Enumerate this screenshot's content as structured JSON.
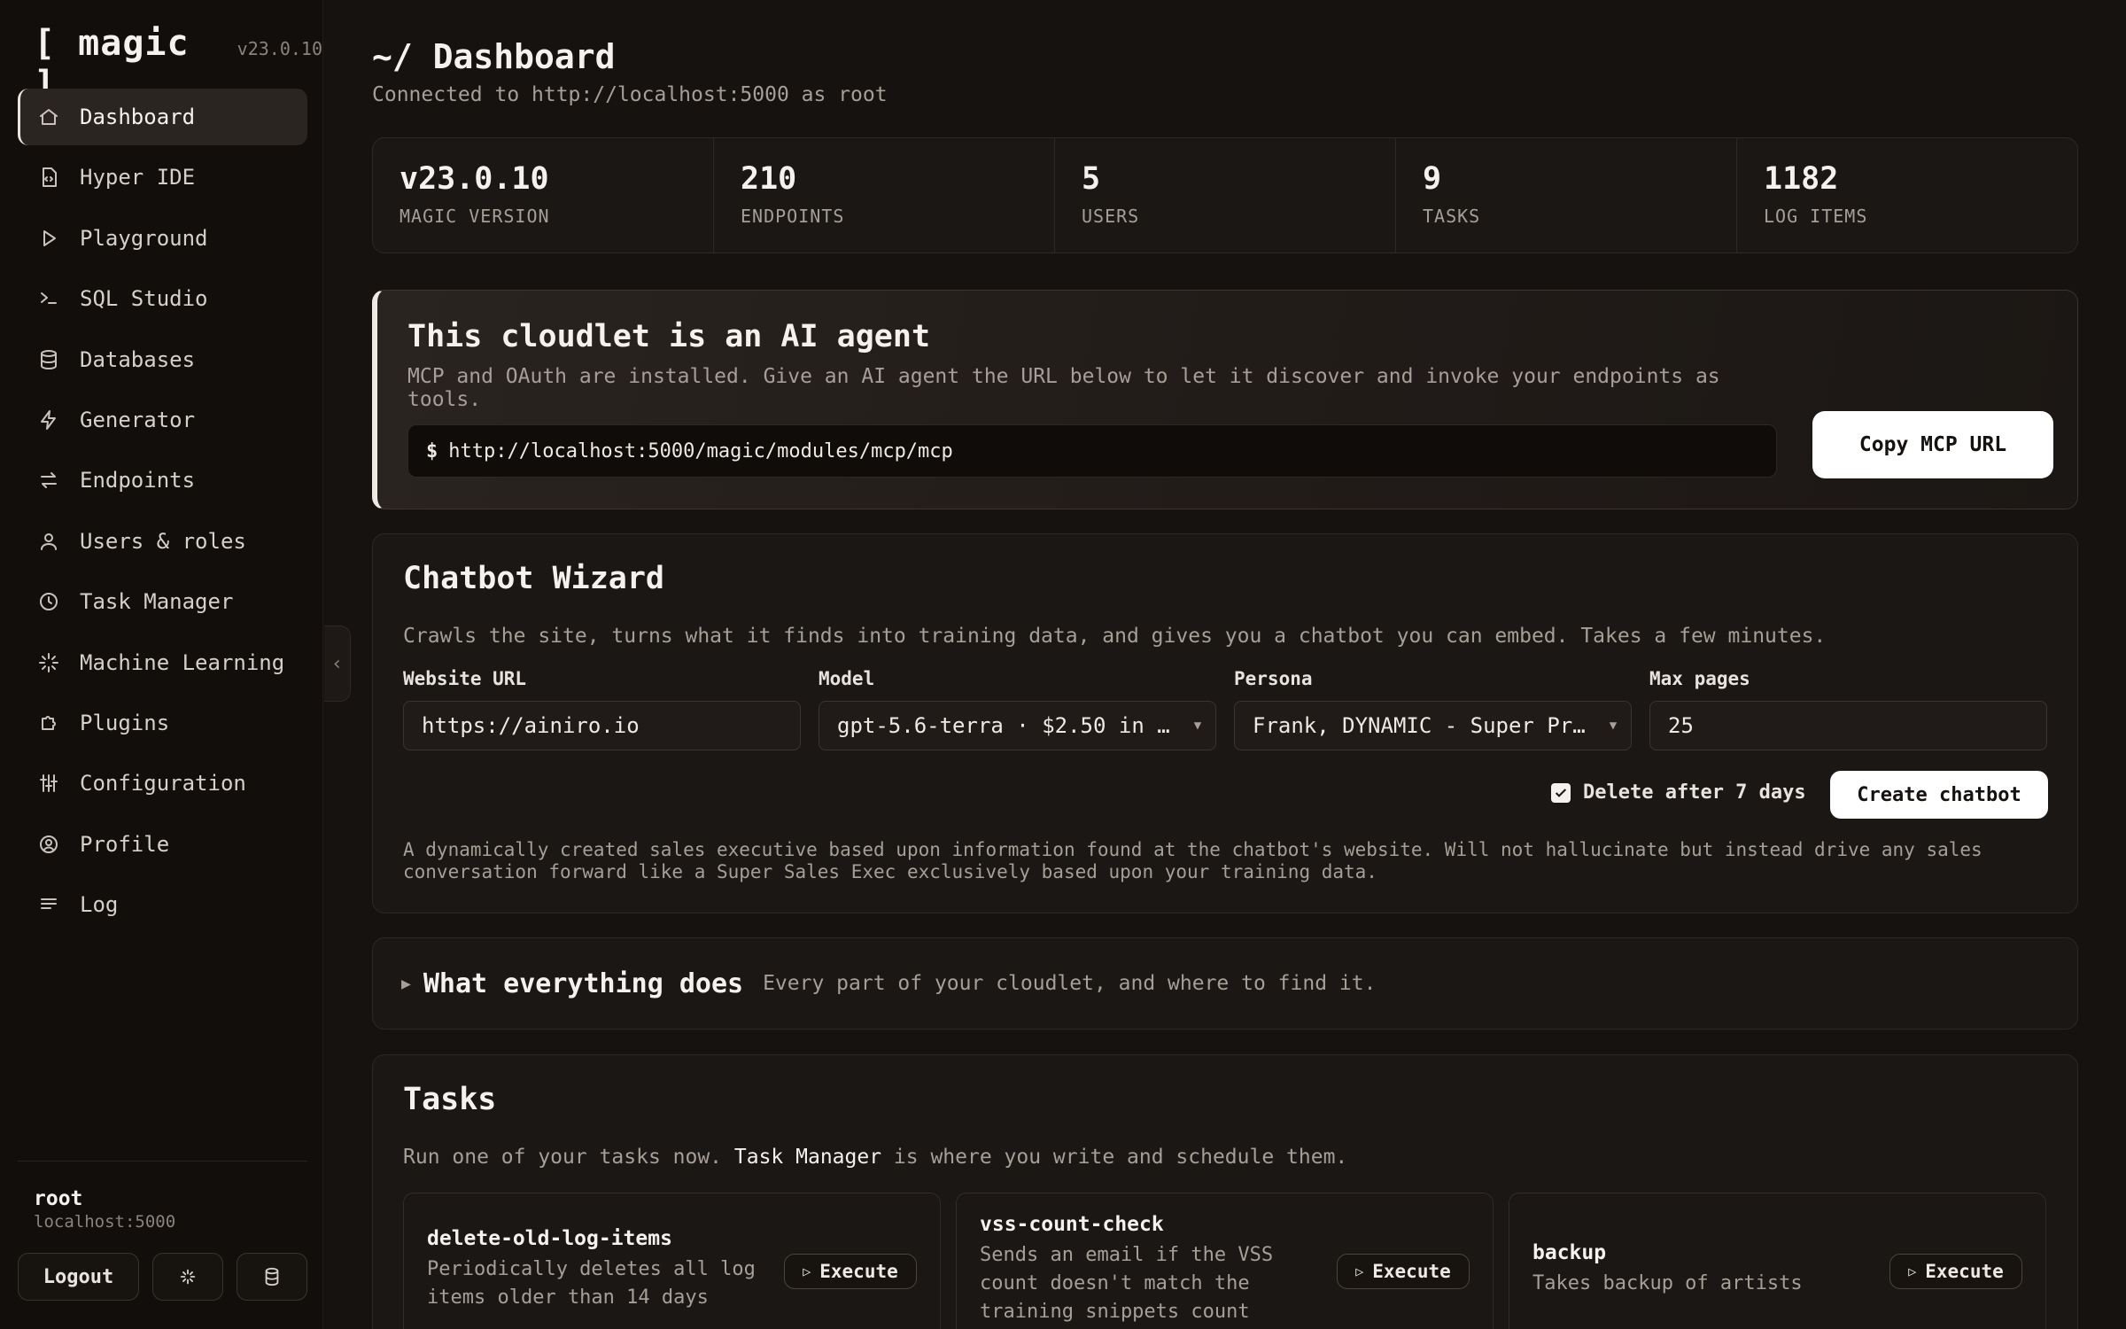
{
  "brand": {
    "name": "[ magic ]",
    "version": "v23.0.10"
  },
  "sidebar": {
    "items": [
      {
        "label": "Dashboard",
        "icon": "home-icon",
        "active": true
      },
      {
        "label": "Hyper IDE",
        "icon": "file-code-icon"
      },
      {
        "label": "Playground",
        "icon": "play-icon"
      },
      {
        "label": "SQL Studio",
        "icon": "terminal-icon"
      },
      {
        "label": "Databases",
        "icon": "database-icon"
      },
      {
        "label": "Generator",
        "icon": "lightning-icon"
      },
      {
        "label": "Endpoints",
        "icon": "arrows-swap-icon"
      },
      {
        "label": "Users & roles",
        "icon": "user-icon"
      },
      {
        "label": "Task Manager",
        "icon": "clock-icon"
      },
      {
        "label": "Machine Learning",
        "icon": "sparkle-icon"
      },
      {
        "label": "Plugins",
        "icon": "puzzle-icon"
      },
      {
        "label": "Configuration",
        "icon": "sliders-icon"
      },
      {
        "label": "Profile",
        "icon": "user-circle-icon"
      },
      {
        "label": "Log",
        "icon": "lines-icon"
      }
    ],
    "user": {
      "name": "root",
      "host": "localhost:5000"
    },
    "logout_label": "Logout"
  },
  "header": {
    "title": "~/ Dashboard",
    "subtitle": "Connected to http://localhost:5000 as root"
  },
  "stats": [
    {
      "value": "v23.0.10",
      "label": "MAGIC VERSION"
    },
    {
      "value": "210",
      "label": "ENDPOINTS"
    },
    {
      "value": "5",
      "label": "USERS"
    },
    {
      "value": "9",
      "label": "TASKS"
    },
    {
      "value": "1182",
      "label": "LOG ITEMS"
    }
  ],
  "agent": {
    "title": "This cloudlet is an AI agent",
    "description": "MCP and OAuth are installed. Give an AI agent the URL below to let it discover and invoke your endpoints as tools.",
    "prompt": "$",
    "url": "http://localhost:5000/magic/modules/mcp/mcp",
    "copy_label": "Copy MCP URL"
  },
  "wizard": {
    "title": "Chatbot Wizard",
    "description": "Crawls the site, turns what it finds into training data, and gives you a chatbot you can embed. Takes a few minutes.",
    "fields": {
      "website_label": "Website URL",
      "website_value": "https://ainiro.io",
      "model_label": "Model",
      "model_value": "gpt-5.6-terra · $2.50 in …",
      "persona_label": "Persona",
      "persona_value": "Frank, DYNAMIC - Super Pr…",
      "maxpages_label": "Max pages",
      "maxpages_value": "25"
    },
    "delete_label": "Delete after 7 days",
    "delete_checked": true,
    "create_label": "Create chatbot",
    "persona_description": "A dynamically created sales executive based upon information found at the chatbot's website. Will not hallucinate but instead drive any sales conversation forward like a Super Sales Exec exclusively based upon your training data."
  },
  "what": {
    "title": "What everything does",
    "subtitle": "Every part of your cloudlet, and where to find it."
  },
  "tasks": {
    "title": "Tasks",
    "desc_before": "Run one of your tasks now.",
    "desc_link": "Task Manager",
    "desc_after": "is where you write and schedule them.",
    "execute_label": "Execute",
    "items": [
      {
        "name": "delete-old-log-items",
        "description": "Periodically deletes all log items older than 14 days"
      },
      {
        "name": "vss-count-check",
        "description": "Sends an email if the VSS count doesn't match the training snippets count"
      },
      {
        "name": "backup",
        "description": "Takes backup of artists"
      }
    ]
  }
}
